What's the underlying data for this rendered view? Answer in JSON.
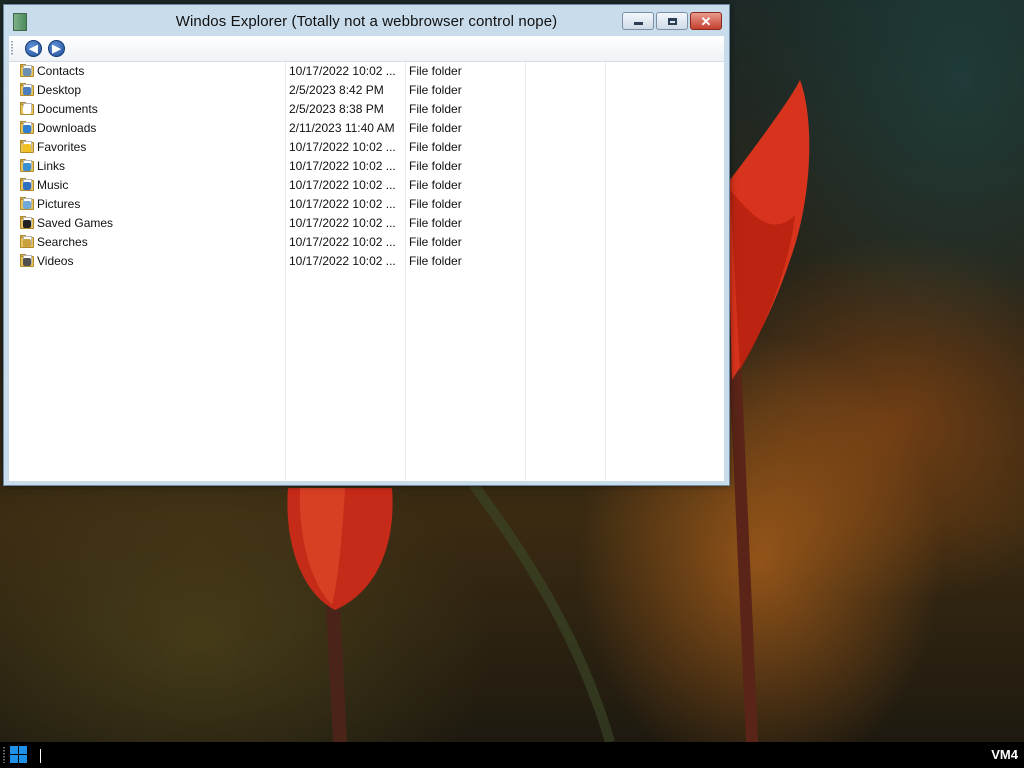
{
  "window": {
    "title": "Windos Explorer (Totally not a webbrowser control nope)",
    "controls": {
      "minimize": "minimize",
      "maximize": "maximize",
      "close": "close"
    }
  },
  "toolbar": {
    "back_icon": "arrow-left-icon",
    "forward_icon": "arrow-right-icon"
  },
  "files": [
    {
      "name": "Contacts",
      "modified": "10/17/2022 10:02 ...",
      "type": "File folder",
      "icon": "contacts-folder-icon"
    },
    {
      "name": "Desktop",
      "modified": "2/5/2023 8:42 PM",
      "type": "File folder",
      "icon": "desktop-folder-icon"
    },
    {
      "name": "Documents",
      "modified": "2/5/2023 8:38 PM",
      "type": "File folder",
      "icon": "documents-folder-icon"
    },
    {
      "name": "Downloads",
      "modified": "2/11/2023 11:40 AM",
      "type": "File folder",
      "icon": "downloads-folder-icon"
    },
    {
      "name": "Favorites",
      "modified": "10/17/2022 10:02 ...",
      "type": "File folder",
      "icon": "favorites-folder-icon"
    },
    {
      "name": "Links",
      "modified": "10/17/2022 10:02 ...",
      "type": "File folder",
      "icon": "links-folder-icon"
    },
    {
      "name": "Music",
      "modified": "10/17/2022 10:02 ...",
      "type": "File folder",
      "icon": "music-folder-icon"
    },
    {
      "name": "Pictures",
      "modified": "10/17/2022 10:02 ...",
      "type": "File folder",
      "icon": "pictures-folder-icon"
    },
    {
      "name": "Saved Games",
      "modified": "10/17/2022 10:02 ...",
      "type": "File folder",
      "icon": "saved-games-folder-icon"
    },
    {
      "name": "Searches",
      "modified": "10/17/2022 10:02 ...",
      "type": "File folder",
      "icon": "searches-folder-icon"
    },
    {
      "name": "Videos",
      "modified": "10/17/2022 10:02 ...",
      "type": "File folder",
      "icon": "videos-folder-icon"
    }
  ],
  "taskbar": {
    "start_icon": "windows-logo-icon",
    "label": "VM4"
  },
  "colors": {
    "window_frame": "#c9dceb",
    "close_button": "#c54030",
    "taskbar": "#000000",
    "start_logo": "#1e90e8"
  }
}
